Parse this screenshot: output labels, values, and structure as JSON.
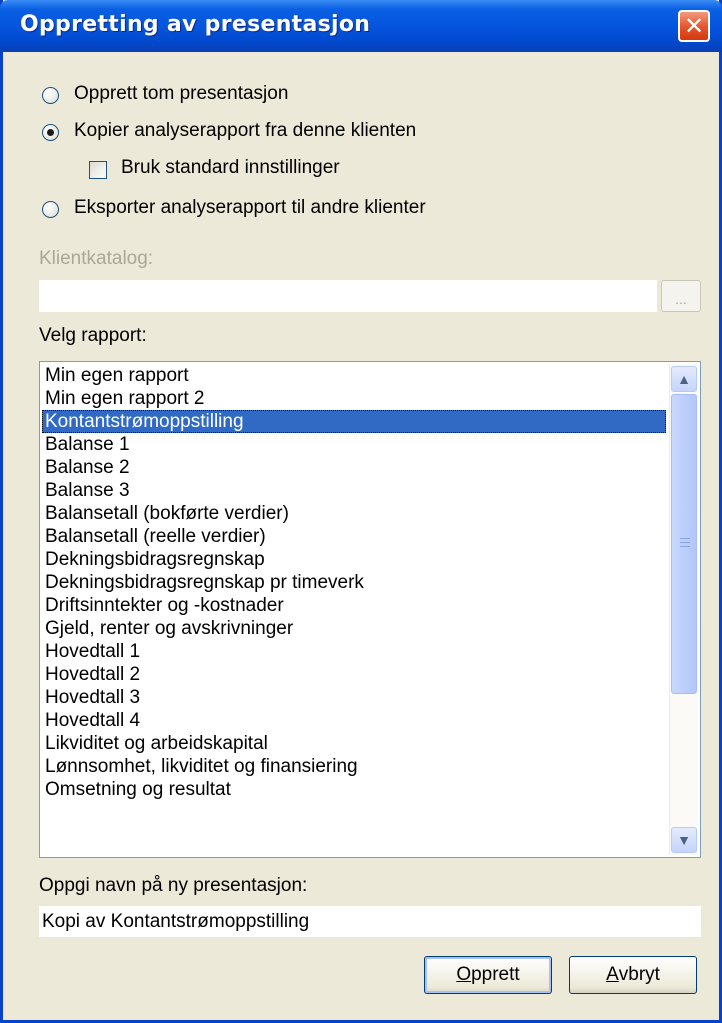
{
  "window": {
    "title": "Oppretting av presentasjon",
    "close_glyph": "✕"
  },
  "options": {
    "create_empty": "Opprett tom presentasjon",
    "copy_report": "Kopier analyserapport fra denne klienten",
    "use_default_settings": "Bruk standard innstillinger",
    "export_report": "Eksporter analyserapport til andre klienter",
    "selected": "copy_report",
    "use_default_settings_checked": false
  },
  "client_folder": {
    "label": "Klientkatalog:",
    "value": "",
    "browse_label": "..."
  },
  "report_list": {
    "label": "Velg rapport:",
    "items": [
      "Min egen rapport",
      "Min egen rapport 2",
      "Kontantstrømoppstilling",
      "Balanse 1",
      "Balanse 2",
      "Balanse 3",
      "Balansetall (bokførte verdier)",
      "Balansetall (reelle verdier)",
      "Dekningsbidragsregnskap",
      "Dekningsbidragsregnskap pr timeverk",
      "Driftsinntekter og -kostnader",
      "Gjeld, renter og avskrivninger",
      "Hovedtall 1",
      "Hovedtall 2",
      "Hovedtall 3",
      "Hovedtall 4",
      "Likviditet og arbeidskapital",
      "Lønnsomhet, likviditet og finansiering",
      "Omsetning og resultat"
    ],
    "selected_index": 2
  },
  "new_name": {
    "label": "Oppgi navn på ny presentasjon:",
    "value": "Kopi av Kontantstrømoppstilling"
  },
  "buttons": {
    "create_accel": "O",
    "create_rest": "pprett",
    "cancel_accel": "A",
    "cancel_rest": "vbryt"
  },
  "colors": {
    "titlebar": "#0453dd",
    "selection": "#316ac5",
    "dialog_bg": "#ece9d8"
  }
}
